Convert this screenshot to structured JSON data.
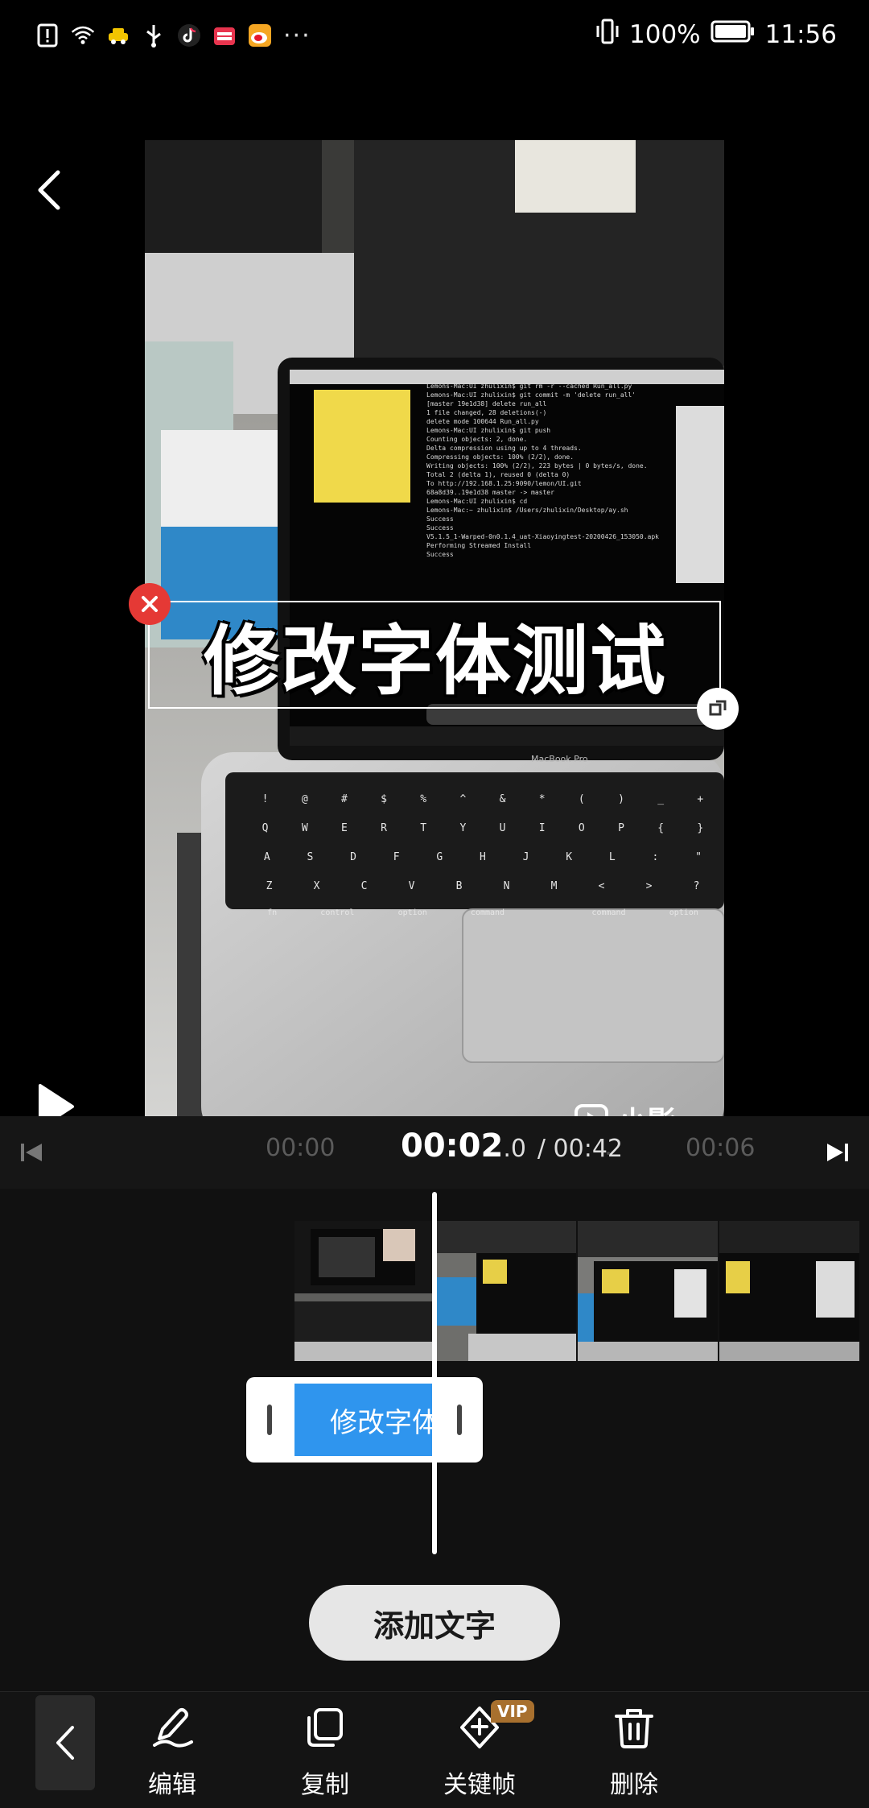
{
  "status_bar": {
    "battery_percent": "100%",
    "time": "11:56",
    "more": "···"
  },
  "preview": {
    "overlay_text": "修改字体测试",
    "watermark": "小影",
    "screen_lines": [
      "Lemons-Mac:UI zhulixin$ git rm -r --cached Run_all.py",
      "Lemons-Mac:UI zhulixin$ git commit -m 'delete run_all'",
      "[master 19e1d38] delete run_all",
      " 1 file changed, 28 deletions(-)",
      " delete mode 100644 Run_all.py",
      "Lemons-Mac:UI zhulixin$ git push",
      "Counting objects: 2, done.",
      "Delta compression using up to 4 threads.",
      "Compressing objects: 100% (2/2), done.",
      "Writing objects: 100% (2/2), 223 bytes | 0 bytes/s, done.",
      "Total 2 (delta 1), reused 0 (delta 0)",
      "To http://192.168.1.25:9090/lemon/UI.git",
      "   68a8d39..19e1d38  master -> master",
      "Lemons-Mac:UI zhulixin$ cd",
      "Lemons-Mac:~ zhulixin$ /Users/zhulixin/Desktop/ay.sh",
      "Success",
      "Success",
      "V5.1.5_1-Warped-0n0.1.4_uat-Xiaoyingtest-20200426_153050.apk",
      "Performing Streamed Install",
      "Success"
    ],
    "laptop_model": "MacBook Pro",
    "keyboard_rows": [
      [
        "!",
        "@",
        "#",
        "$",
        "%",
        "^",
        "&",
        "*",
        "(",
        ")",
        "_",
        "+"
      ],
      [
        "Q",
        "W",
        "E",
        "R",
        "T",
        "Y",
        "U",
        "I",
        "O",
        "P",
        "{",
        "}"
      ],
      [
        "A",
        "S",
        "D",
        "F",
        "G",
        "H",
        "J",
        "K",
        "L",
        ":",
        "\""
      ],
      [
        "Z",
        "X",
        "C",
        "V",
        "B",
        "N",
        "M",
        "<",
        ">",
        "?"
      ]
    ],
    "keyboard_bottom": [
      "fn",
      "control",
      "option",
      "command",
      "",
      "command",
      "option"
    ]
  },
  "timeline": {
    "tick_left": "00:00",
    "tick_right": "00:06",
    "current_time": "00:02",
    "current_fraction": ".0",
    "total_time": "/ 00:42",
    "text_clip_label": "修改字体测试"
  },
  "actions": {
    "add_text": "添加文字"
  },
  "toolbar": {
    "items": [
      {
        "label": "编辑",
        "icon": "pen-icon"
      },
      {
        "label": "复制",
        "icon": "copy-icon"
      },
      {
        "label": "关键帧",
        "icon": "keyframe-icon",
        "badge": "VIP"
      },
      {
        "label": "删除",
        "icon": "trash-icon"
      }
    ]
  },
  "colors": {
    "accent_blue": "#2f95ee",
    "delete_red": "#e53935",
    "vip_gold": "#a8702e"
  }
}
